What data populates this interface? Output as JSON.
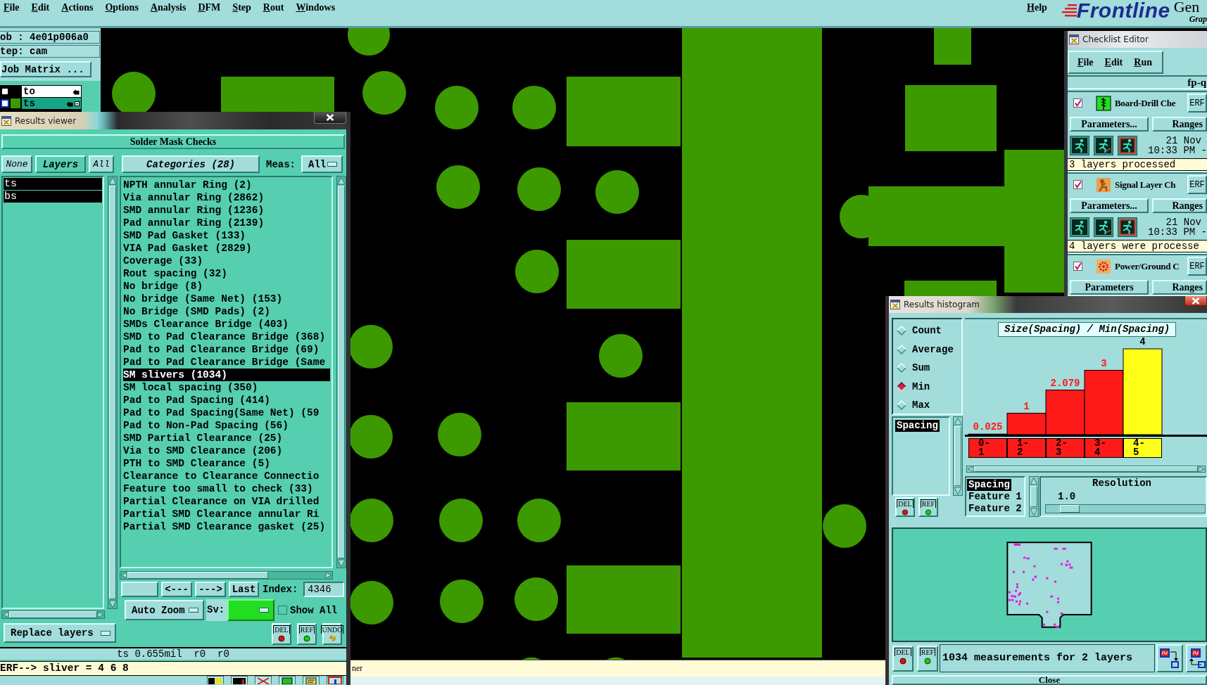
{
  "menu_bar": {
    "items": [
      "File",
      "Edit",
      "Actions",
      "Options",
      "Analysis",
      "DFM",
      "Step",
      "Rout",
      "Windows"
    ],
    "help": "Help"
  },
  "logo": {
    "brand": "Frontline",
    "title": "Gen",
    "subtitle": "Grap"
  },
  "job_panel": {
    "job": "ob : 4e01p006a0",
    "step": "tep: cam",
    "matrix_button": "Job Matrix ...",
    "layers": [
      {
        "name": "to",
        "selected": false,
        "checked": false
      },
      {
        "name": "ts",
        "selected": true,
        "checked": false,
        "color": "#3c9a00"
      }
    ]
  },
  "status_bar": {
    "message": "ner"
  },
  "results_viewer": {
    "title": "Results viewer",
    "heading": "Solder Mask Checks",
    "layer_buttons": {
      "none": "None",
      "label": "Layers",
      "all": "All"
    },
    "categories_button": "Categories (28)",
    "meas_label": "Meas:",
    "meas_value": "All",
    "layers": [
      {
        "name": "ts",
        "selected": true
      },
      {
        "name": "bs",
        "selected": true
      }
    ],
    "categories": [
      {
        "label": "NPTH annular Ring (2)",
        "selected": false
      },
      {
        "label": "Via annular Ring (2862)",
        "selected": false
      },
      {
        "label": "SMD annular Ring (1236)",
        "selected": false
      },
      {
        "label": "Pad annular Ring (2139)",
        "selected": false
      },
      {
        "label": "SMD Pad Gasket (133)",
        "selected": false
      },
      {
        "label": "VIA Pad Gasket (2829)",
        "selected": false
      },
      {
        "label": "Coverage (33)",
        "selected": false
      },
      {
        "label": "Rout spacing (32)",
        "selected": false
      },
      {
        "label": "No bridge (8)",
        "selected": false
      },
      {
        "label": "No bridge (Same Net) (153)",
        "selected": false
      },
      {
        "label": "No Bridge (SMD Pads) (2)",
        "selected": false
      },
      {
        "label": "SMDs Clearance Bridge (403)",
        "selected": false
      },
      {
        "label": "SMD to Pad Clearance Bridge (368)",
        "selected": false
      },
      {
        "label": "Pad to Pad Clearance Bridge (69)",
        "selected": false
      },
      {
        "label": "Pad to Pad Clearance Bridge (Same",
        "selected": false
      },
      {
        "label": "SM slivers (1034)",
        "selected": true
      },
      {
        "label": "SM local spacing (350)",
        "selected": false
      },
      {
        "label": "Pad to Pad Spacing (414)",
        "selected": false
      },
      {
        "label": "Pad to Pad Spacing(Same Net) (59",
        "selected": false
      },
      {
        "label": "Pad to Non-Pad Spacing (56)",
        "selected": false
      },
      {
        "label": "SMD Partial Clearance (25)",
        "selected": false
      },
      {
        "label": "Via to SMD Clearance (206)",
        "selected": false
      },
      {
        "label": "PTH to SMD Clearance (5)",
        "selected": false
      },
      {
        "label": "Clearance to Clearance Connectio",
        "selected": false
      },
      {
        "label": "Feature too small to check (33)",
        "selected": false
      },
      {
        "label": "Partial Clearance on VIA drilled",
        "selected": false
      },
      {
        "label": "Partial SMD Clearance annular Ri",
        "selected": false
      },
      {
        "label": "Partial SMD Clearance gasket (25)",
        "selected": false
      }
    ],
    "nav": {
      "prev": "<---",
      "next": "--->",
      "last": "Last",
      "index_label": "Index:",
      "index_value": "4346"
    },
    "zoom_mode": "Auto Zoom",
    "sv_label": "Sv:",
    "show_all": {
      "label": "Show All",
      "checked": false
    },
    "buttons": [
      {
        "label": "DEL",
        "kind": "delete"
      },
      {
        "label": "REF",
        "kind": "refresh"
      },
      {
        "label": "UNDO",
        "kind": "undo"
      }
    ],
    "replace_mode": "Replace layers",
    "measurement": "ts 0.655mil  r0  r0",
    "message": "ERF--> sliver = 4 6 8"
  },
  "checklist_editor": {
    "title": "Checklist Editor",
    "menu": [
      "File",
      "Edit",
      "Run"
    ],
    "name": "fp-q",
    "checks": [
      {
        "kind": "drill",
        "checked": true,
        "name": "Board-Drill Che",
        "erf": "ERF",
        "parameters": "Parameters...",
        "ranges": "Ranges",
        "date": "21 Nov",
        "time": "10:33 PM -",
        "status": "3 layers processed"
      },
      {
        "kind": "signal",
        "checked": true,
        "name": "Signal Layer Ch",
        "erf": "ERF",
        "parameters": "Parameters...",
        "ranges": "Ranges",
        "date": "21 Nov",
        "time": "10:33 PM -",
        "status": "4 layers were processe"
      },
      {
        "kind": "power",
        "checked": true,
        "name": "Power/Ground C",
        "erf": "ERF",
        "parameters": "Parameters",
        "ranges": "Ranges"
      }
    ]
  },
  "results_histogram": {
    "title": "Results histogram",
    "modes": [
      {
        "label": "Count",
        "selected": false
      },
      {
        "label": "Average",
        "selected": false
      },
      {
        "label": "Sum",
        "selected": false
      },
      {
        "label": "Min",
        "selected": true
      },
      {
        "label": "Max",
        "selected": false
      }
    ],
    "measures": [
      {
        "label": "Spacing",
        "selected": true
      }
    ],
    "list_buttons": [
      {
        "label": "DEL",
        "kind": "delete"
      },
      {
        "label": "REF",
        "kind": "refresh"
      }
    ],
    "chart_data": {
      "type": "bar",
      "title": "Size(Spacing) / Min(Spacing)",
      "categories": [
        "0-1",
        "1-2",
        "2-3",
        "3-4",
        "4-5"
      ],
      "series": [
        {
          "color": "#ff1a1a",
          "values": [
            0.025,
            1,
            2.079,
            3,
            null
          ]
        },
        {
          "color": "#ffff1a",
          "values": [
            null,
            null,
            null,
            null,
            4
          ]
        }
      ],
      "data_labels": true
    },
    "features": [
      {
        "label": "Spacing",
        "selected": true
      },
      {
        "label": "Feature 1",
        "selected": false
      },
      {
        "label": "Feature 2",
        "selected": false
      }
    ],
    "resolution": {
      "label": "Resolution",
      "value": "1.0",
      "level": 0.1
    },
    "buttons": [
      {
        "label": "DEL",
        "kind": "delete"
      },
      {
        "label": "REF",
        "kind": "refresh"
      }
    ],
    "summary": "1034 measurements for 2 layers",
    "close": "Close"
  }
}
